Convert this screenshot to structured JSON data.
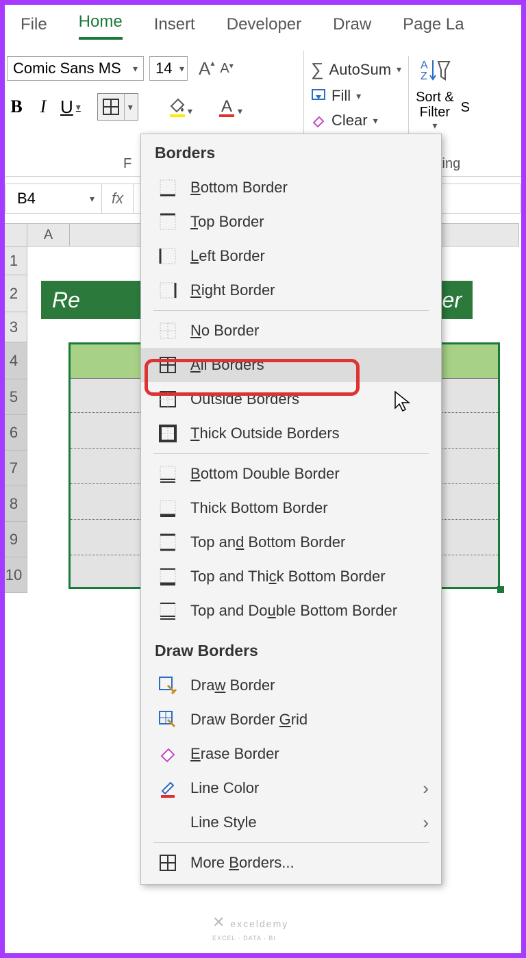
{
  "tabs": {
    "file": "File",
    "home": "Home",
    "insert": "Insert",
    "developer": "Developer",
    "draw": "Draw",
    "pagelayout": "Page La"
  },
  "font": {
    "name": "Comic Sans MS",
    "size": "14",
    "grow": "A",
    "shrink": "A",
    "bold": "B",
    "italic": "I",
    "underline": "U",
    "groupLabel": "F"
  },
  "editing": {
    "autosum": "AutoSum",
    "fill": "Fill",
    "clear": "Clear",
    "sortfilter": "Sort &\nFilter",
    "s": "S",
    "groupLabel": "ting"
  },
  "namebox": "B4",
  "fx": "fx",
  "colA": "A",
  "rows": [
    "1",
    "2",
    "3",
    "4",
    "5",
    "6",
    "7",
    "8",
    "9",
    "10"
  ],
  "titleCell": {
    "prefix": "Re",
    "suffix": "er"
  },
  "dropdown": {
    "header1": "Borders",
    "header2": "Draw Borders",
    "items": {
      "bottom": "ottom Border",
      "top": "op Border",
      "left": "eft Border",
      "right": "ight Border",
      "none": "o Border",
      "all": "ll Borders",
      "outside": "ide Borders",
      "thickoutside": "hick Outside Borders",
      "bottomdouble": "ottom Double Border",
      "thickbottom": "ick Bottom Border",
      "topbottom": " Bottom Border",
      "topthickbottom": "k Bottom Border",
      "topdoublebottom": "ble Bottom Border",
      "draw": "Dra",
      "drawgrid": "Draw Border ",
      "erase": "rase Border",
      "linecolor": "Line Color",
      "linestyle": "Line Style",
      "more": "More "
    },
    "parts": {
      "b": "B",
      "t": "T",
      "l": "L",
      "r": "R",
      "n": "N",
      "a": "A",
      "outs": "Outs",
      "th": "Th",
      "topand": "Top an",
      "d": "d",
      "topthic": "Top and Thi",
      "c": "c",
      "topdou": "Top and Do",
      "u": "u",
      "w": "w",
      "dborder": " Border",
      "g": "G",
      "rid": "rid",
      "e": "E",
      "borders": "orders...",
      "bword": "B"
    }
  },
  "watermark": {
    "main": "exceldemy",
    "sub": "EXCEL · DATA · BI"
  }
}
